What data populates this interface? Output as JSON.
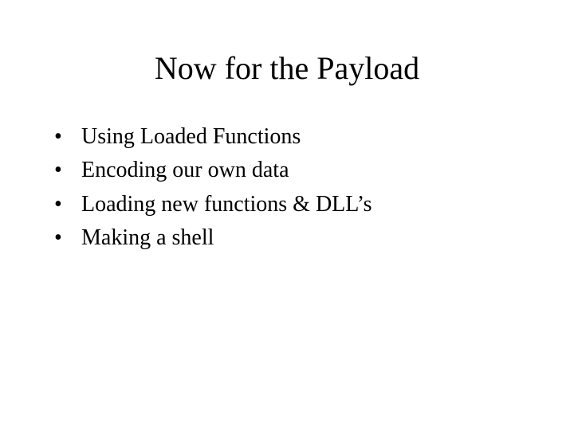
{
  "slide": {
    "title": "Now for the Payload",
    "bullets": [
      "Using Loaded Functions",
      "Encoding our own data",
      "Loading new functions & DLL’s",
      "Making a shell"
    ]
  }
}
